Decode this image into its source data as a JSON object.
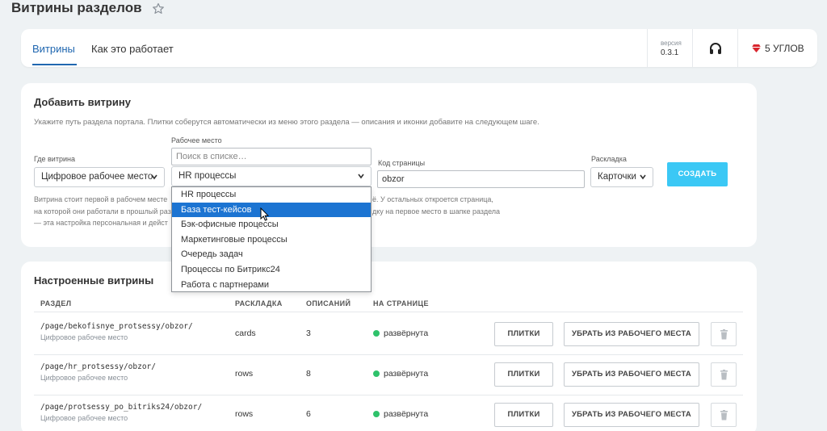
{
  "page": {
    "title": "Витрины разделов"
  },
  "tabs": [
    {
      "label": "Витрины",
      "active": true
    },
    {
      "label": "Как это работает",
      "active": false
    }
  ],
  "version": {
    "label": "версия",
    "value": "0.3.1"
  },
  "angles": {
    "label": "5 УГЛОВ"
  },
  "add_form": {
    "title": "Добавить витрину",
    "description": "Укажите путь раздела портала. Плитки соберутся автоматически из меню этого раздела — описания и иконки добавите на следующем шаге.",
    "where_label": "Где витрина",
    "where_value": "Цифровое рабочее место",
    "workplace_label": "Рабочее место",
    "search_placeholder": "Поиск в списке…",
    "workplace_value": "HR процессы",
    "code_label": "Код страницы",
    "code_value": "obzor",
    "layout_label": "Раскладка",
    "layout_value": "Карточки",
    "create_button": "СОЗДАТЬ",
    "note_lines": [
      "Витрина стоит первой в рабочем месте",
      "на которой они работали в прошлый раз",
      "— эта настройка персональная и дейст"
    ],
    "note_right_lines": [
      "ё. У остальных откроется страница,",
      "дку на первое место в шапке раздела"
    ]
  },
  "dropdown": {
    "options": [
      "HR процессы",
      "База тест-кейсов",
      "Бэк-офисные процессы",
      "Маркетинговые процессы",
      "Очередь задач",
      "Процессы по Битрикс24",
      "Работа с партнерами"
    ],
    "highlighted_index": 1
  },
  "configured": {
    "title": "Настроенные витрины",
    "headers": {
      "section": "РАЗДЕЛ",
      "layout": "РАСКЛАДКА",
      "count": "ОПИСАНИЙ",
      "onpage": "НА СТРАНИЦЕ"
    },
    "rows": [
      {
        "path": "/page/bekofisnye_protsessy/obzor/",
        "workplace": "Цифровое рабочее место",
        "layout": "cards",
        "count": "3",
        "status": "развёрнута",
        "tiles_button": "ПЛИТКИ",
        "remove_button": "УБРАТЬ ИЗ РАБОЧЕГО МЕСТА"
      },
      {
        "path": "/page/hr_protsessy/obzor/",
        "workplace": "Цифровое рабочее место",
        "layout": "rows",
        "count": "8",
        "status": "развёрнута",
        "tiles_button": "ПЛИТКИ",
        "remove_button": "УБРАТЬ ИЗ РАБОЧЕГО МЕСТА"
      },
      {
        "path": "/page/protsessy_po_bitriks24/obzor/",
        "workplace": "Цифровое рабочее место",
        "layout": "rows",
        "count": "6",
        "status": "развёрнута",
        "tiles_button": "ПЛИТКИ",
        "remove_button": "УБРАТЬ ИЗ РАБОЧЕГО МЕСТА"
      }
    ]
  },
  "colors": {
    "accent": "#2067b0",
    "create_button": "#3bc8f5",
    "status_dot": "#2fc26b",
    "highlight": "#1c74d2"
  }
}
